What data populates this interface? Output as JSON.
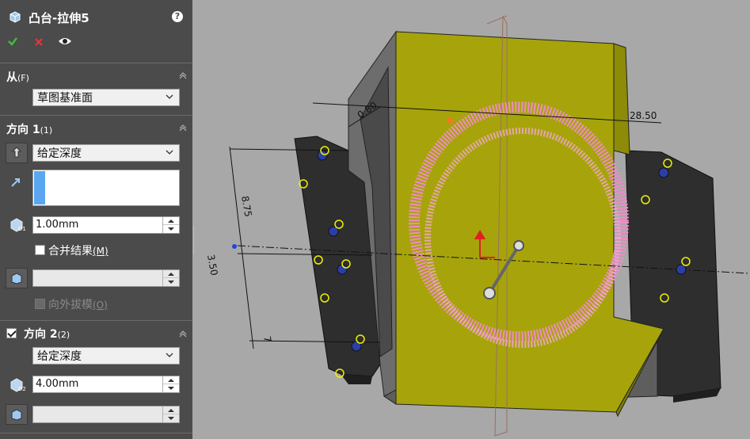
{
  "panel": {
    "title": "凸台-拉伸5",
    "help": "?",
    "ok_icon": "check-icon",
    "cancel_icon": "x-icon",
    "preview_icon": "eye-icon",
    "from": {
      "title": "从",
      "key": "(F)",
      "value": "草图基准面"
    },
    "direction1": {
      "title": "方向 1",
      "key": "(1)",
      "end_condition": "给定深度",
      "depth": "1.00mm",
      "merge_label": "合并结果",
      "merge_key": "(M)",
      "merge_checked": false,
      "draft_value": "",
      "draft_outward_label": "向外拔模",
      "draft_outward_key": "(O)"
    },
    "direction2": {
      "title": "方向 2",
      "key": "(2)",
      "checked": true,
      "end_condition": "给定深度",
      "depth": "4.00mm",
      "draft_value": ""
    }
  },
  "viewport": {
    "dimensions": {
      "d_080": "0.80",
      "d_2850": "28.50",
      "d_875": "8.75",
      "d_350": "3.50",
      "d_7": "7"
    },
    "colors": {
      "face_yellow": "#a6a40a",
      "preview_pink": "#f08cc6",
      "body_black": "#2e2e2e",
      "frame_gray": "#6d6d6d"
    }
  }
}
